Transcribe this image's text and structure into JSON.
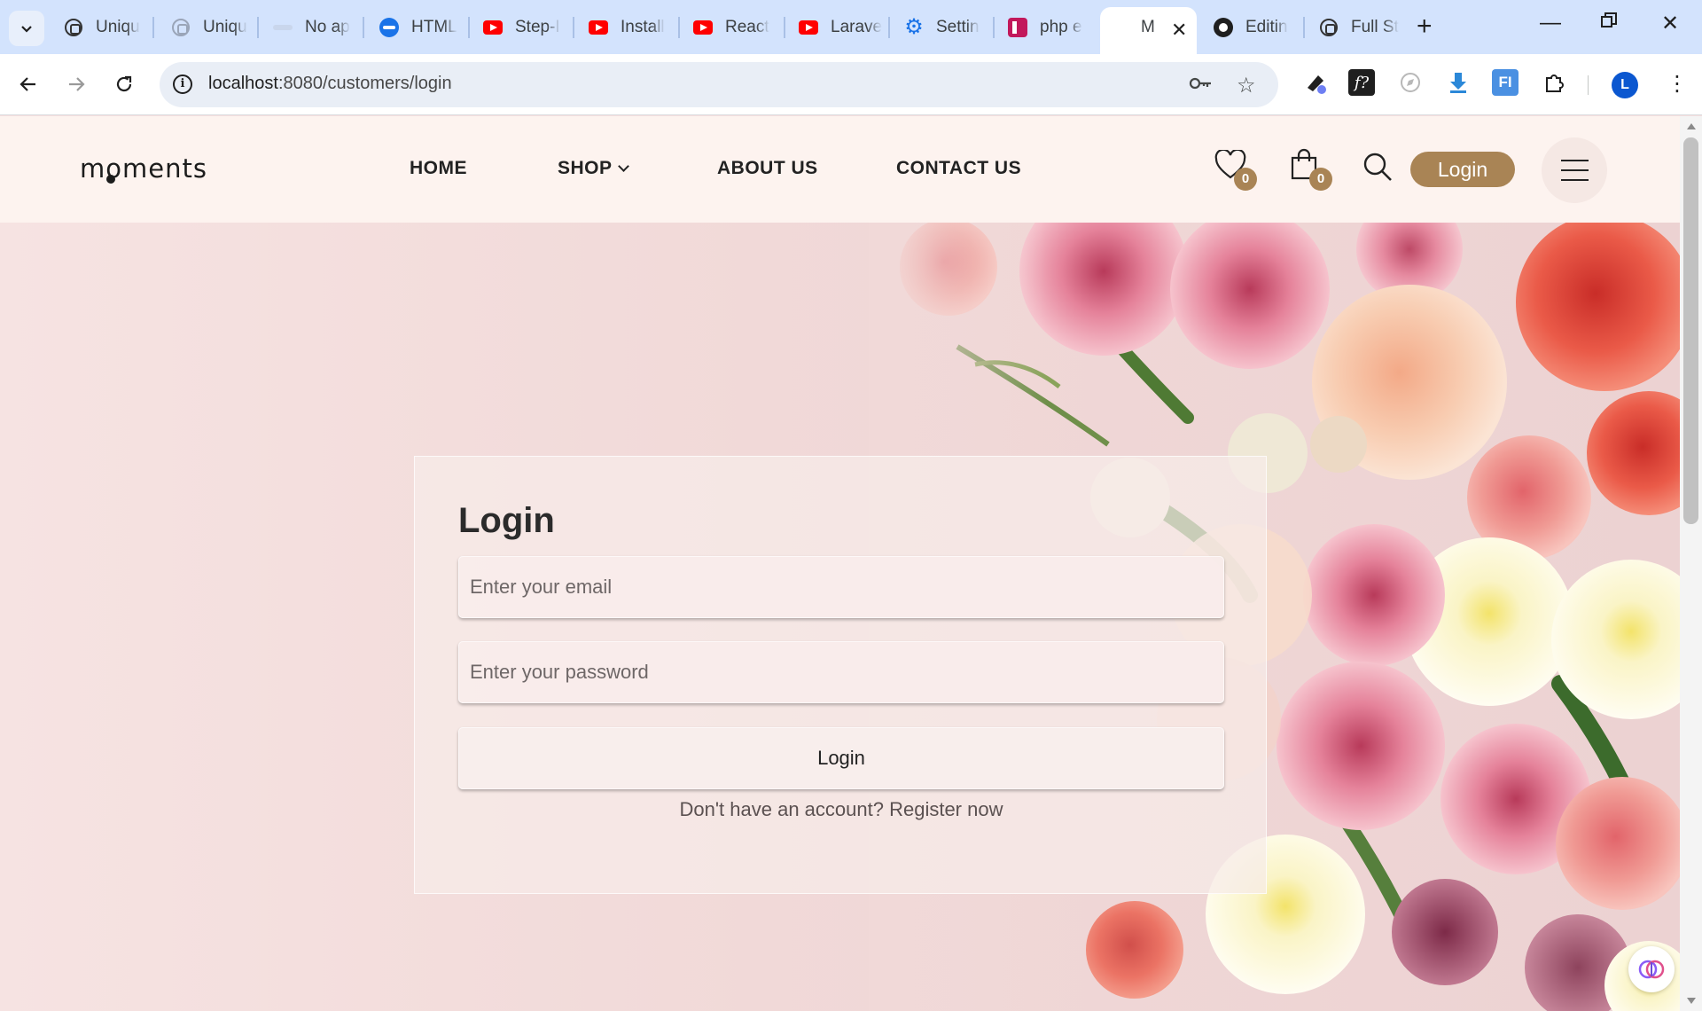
{
  "browser": {
    "tabs": [
      {
        "title": "Uniqu",
        "icon": "chatgpt-icon"
      },
      {
        "title": "Uniqu",
        "icon": "chatgpt-icon"
      },
      {
        "title": "No ap",
        "icon": "blank-page-icon"
      },
      {
        "title": "HTML",
        "icon": "html-icon"
      },
      {
        "title": "Step-I",
        "icon": "youtube-icon"
      },
      {
        "title": "Install",
        "icon": "youtube-icon"
      },
      {
        "title": "React",
        "icon": "youtube-icon"
      },
      {
        "title": "Larave",
        "icon": "youtube-icon"
      },
      {
        "title": "Settin",
        "icon": "gear-icon"
      },
      {
        "title": "php e",
        "icon": "php-icon"
      },
      {
        "title": "M",
        "icon": "none",
        "active": true
      },
      {
        "title": "Editin",
        "icon": "github-icon"
      },
      {
        "title": "Full St",
        "icon": "chatgpt-icon"
      }
    ],
    "url_host": "localhost",
    "url_path": ":8080/customers/login",
    "profile_initial": "L"
  },
  "site": {
    "logo": "moments",
    "nav": {
      "home": "HOME",
      "shop": "SHOP",
      "about": "ABOUT US",
      "contact": "CONTACT US"
    },
    "wishlist_count": "0",
    "cart_count": "0",
    "login_button": "Login",
    "accent_color": "#a98455"
  },
  "login_form": {
    "title": "Login",
    "email_placeholder": "Enter your email",
    "password_placeholder": "Enter your password",
    "submit_label": "Login",
    "register_text": "Don't have an account? Register now"
  }
}
